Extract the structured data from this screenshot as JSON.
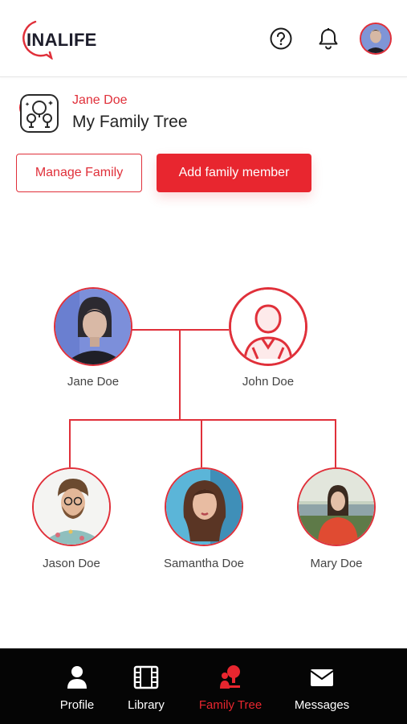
{
  "header": {
    "logo_text": "INALIFE",
    "help_icon": "help-circle-icon",
    "bell_icon": "bell-icon",
    "avatar": "user-avatar"
  },
  "tree_header": {
    "owner_name": "Jane Doe",
    "title": "My Family Tree"
  },
  "actions": {
    "manage_label": "Manage Family",
    "add_label": "Add family member"
  },
  "tree": {
    "parents": [
      {
        "name": "Jane Doe",
        "photo": true
      },
      {
        "name": "John Doe",
        "photo": false
      }
    ],
    "children": [
      {
        "name": "Jason Doe"
      },
      {
        "name": "Samantha Doe"
      },
      {
        "name": "Mary Doe"
      }
    ]
  },
  "nav": {
    "items": [
      {
        "label": "Profile",
        "icon": "person-icon",
        "active": false
      },
      {
        "label": "Library",
        "icon": "film-icon",
        "active": false
      },
      {
        "label": "Family Tree",
        "icon": "family-tree-icon",
        "active": true
      },
      {
        "label": "Messages",
        "icon": "envelope-icon",
        "active": false
      }
    ]
  },
  "colors": {
    "accent": "#e8262f",
    "nav_background": "#050505"
  }
}
